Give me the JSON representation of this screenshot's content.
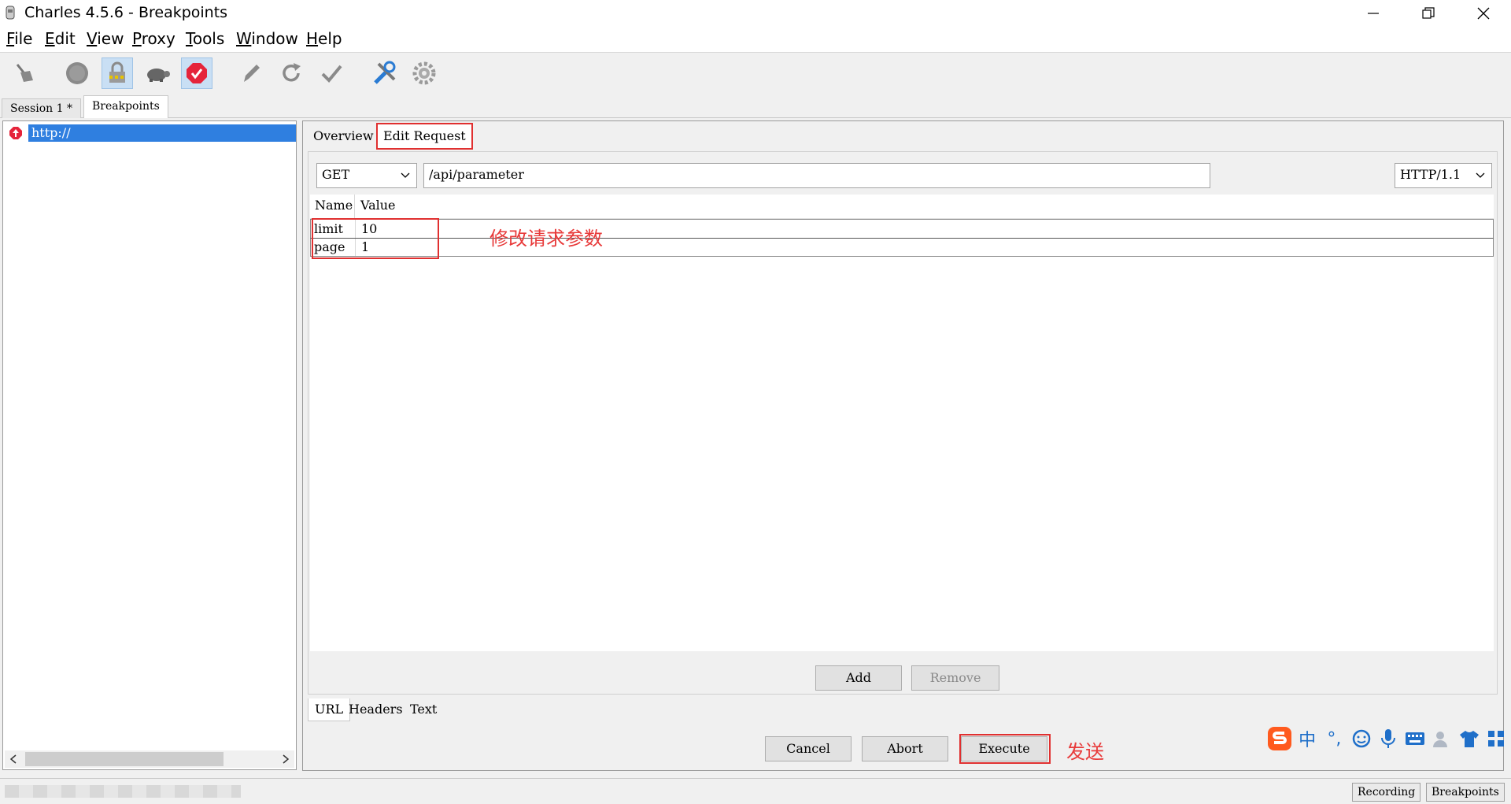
{
  "window": {
    "title": "Charles 4.5.6 - Breakpoints"
  },
  "menu": [
    "File",
    "Edit",
    "View",
    "Proxy",
    "Tools",
    "Window",
    "Help"
  ],
  "toolbar": {
    "icons": [
      "broom-icon",
      "record-icon",
      "ssl-proxying-icon",
      "throttle-turtle-icon",
      "breakpoints-icon",
      "pen-icon",
      "refresh-icon",
      "check-icon",
      "tools-icon",
      "settings-gear-icon"
    ],
    "active": [
      "ssl-proxying-icon",
      "breakpoints-icon"
    ]
  },
  "session_tabs": [
    "Session 1 *",
    "Breakpoints"
  ],
  "tree": {
    "label": "http://"
  },
  "detail_tabs": [
    "Overview",
    "Edit Request"
  ],
  "request": {
    "method": "GET",
    "path": "/api/parameter",
    "protocol": "HTTP/1.1"
  },
  "params_table": {
    "headers": [
      "Name",
      "Value"
    ],
    "rows": [
      {
        "name": "limit",
        "value": "10"
      },
      {
        "name": "page",
        "value": "1"
      }
    ]
  },
  "table_buttons": {
    "add": "Add",
    "remove": "Remove"
  },
  "bottom_tabs": [
    "URL",
    "Headers",
    "Text"
  ],
  "actions": {
    "cancel": "Cancel",
    "abort": "Abort",
    "execute": "Execute"
  },
  "annotations": {
    "params": "修改请求参数",
    "send": "发送"
  },
  "ime": {
    "lang": "中",
    "punct": "°,"
  },
  "status": {
    "recording": "Recording",
    "breakpoints": "Breakpoints"
  },
  "colors": {
    "highlight": "#2f7fe0",
    "annotation": "#e83a3a",
    "ime_blue": "#1f6fc9"
  }
}
